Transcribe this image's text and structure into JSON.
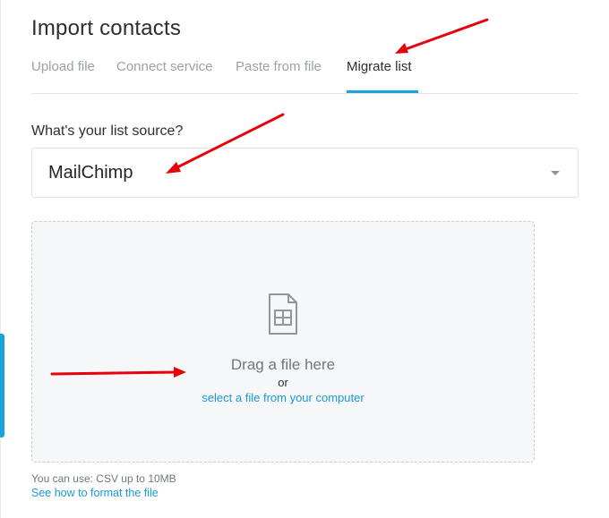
{
  "page": {
    "title": "Import contacts"
  },
  "tabs": [
    {
      "label": "Upload file",
      "active": false
    },
    {
      "label": "Connect service",
      "active": false
    },
    {
      "label": "Paste from file",
      "active": false
    },
    {
      "label": "Migrate list",
      "active": true
    }
  ],
  "source": {
    "question": "What's your list source?",
    "selected": "MailChimp"
  },
  "dropzone": {
    "title": "Drag a file here",
    "or": "or",
    "link": "select a file from your computer",
    "icon": "spreadsheet-file-icon"
  },
  "footer": {
    "note": "You can use: CSV up to 10MB",
    "link": "See how to format the file"
  },
  "colors": {
    "accent": "#16a3e0",
    "link": "#1a9ad6",
    "annotation": "#e8000b"
  }
}
